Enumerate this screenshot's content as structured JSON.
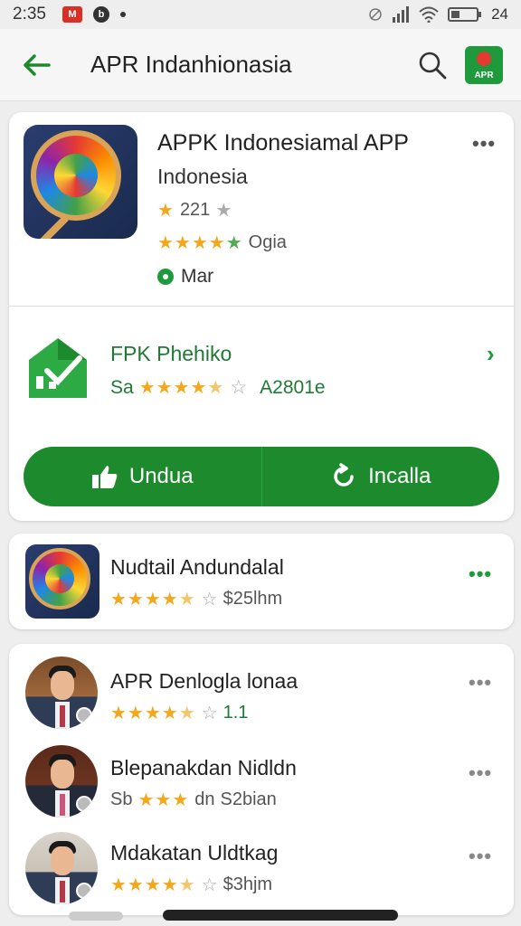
{
  "status_bar": {
    "time": "2:35",
    "battery_text": "24"
  },
  "app_bar": {
    "title": "APR Indanhionasia",
    "logo_text": "APR"
  },
  "featured": {
    "title": "APPK Indonesiamal APP",
    "subtitle": "Indonesia",
    "rating_text": "221",
    "reviews_text": "Ogia",
    "status_text": "Mar",
    "more": "•••"
  },
  "secondary": {
    "title": "FPK Phehiko",
    "prefix": "Sa",
    "rating_stars": 4.5,
    "meta_text": "A2801e",
    "chevron": "›"
  },
  "actions": {
    "download_label": "Undua",
    "install_label": "Incalla"
  },
  "list_card": {
    "title": "Nudtail Andundalal",
    "rating_stars": 4.5,
    "meta_text": "$25lhm",
    "more": "•••"
  },
  "people": [
    {
      "name": "APR Denlogla lonaa",
      "rating_stars": 4.5,
      "meta_text": "1.1",
      "prefix": ""
    },
    {
      "name": "Blepanakdan Nidldn",
      "rating_stars": 3,
      "meta_text": "S2bian",
      "prefix": "Sb",
      "mid": "dn"
    },
    {
      "name": "Mdakatan Uldtkag",
      "rating_stars": 4.5,
      "meta_text": "$3hjm",
      "prefix": ""
    }
  ],
  "colors": {
    "accent": "#1e8a2e",
    "star": "#f2a81d",
    "brand_red": "#e43a2f"
  }
}
